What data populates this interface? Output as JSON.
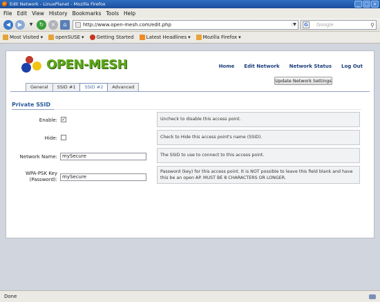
{
  "window": {
    "title": "Edit Network - LinuxPlanet - Mozilla Firefox"
  },
  "menu": [
    "File",
    "Edit",
    "View",
    "History",
    "Bookmarks",
    "Tools",
    "Help"
  ],
  "nav": {
    "url": "http://www.open-mesh.com/edit.php",
    "search_placeholder": "Google"
  },
  "bookmarks": [
    "Most Visited",
    "openSUSE",
    "Getting Started",
    "Latest Headlines",
    "Mozilla Firefox"
  ],
  "page": {
    "logo_text": "OPEN-MESH",
    "topnav": [
      "Home",
      "Edit Network",
      "Network Status",
      "Log Out"
    ],
    "update_button": "Update Network Settings",
    "tabs": [
      "General",
      "SSID #1",
      "SSID #2",
      "Advanced"
    ],
    "active_tab": "SSID #2",
    "section_title": "Private SSID",
    "fields": {
      "enable": {
        "label": "Enable:",
        "checked": true,
        "help": "Uncheck to disable this access point."
      },
      "hide": {
        "label": "Hide:",
        "checked": false,
        "help": "Check to Hide this access point's name (SSID)."
      },
      "network_name": {
        "label": "Network Name:",
        "value": "mySecure",
        "help": "The SSID to use to connect to this access point."
      },
      "wpa_key": {
        "label_line1": "WPA-PSK Key",
        "label_line2": "(Password):",
        "value": "mySecure",
        "help": "Password (key) for this access point. It is NOT possible to leave this field blank and have this be an open AP. MUST BE 8 CHARACTERS OR LONGER."
      }
    }
  },
  "status": {
    "text": "Done"
  },
  "colors": {
    "accent": "#2a5a9c",
    "logo_green": "#5fa81a"
  }
}
